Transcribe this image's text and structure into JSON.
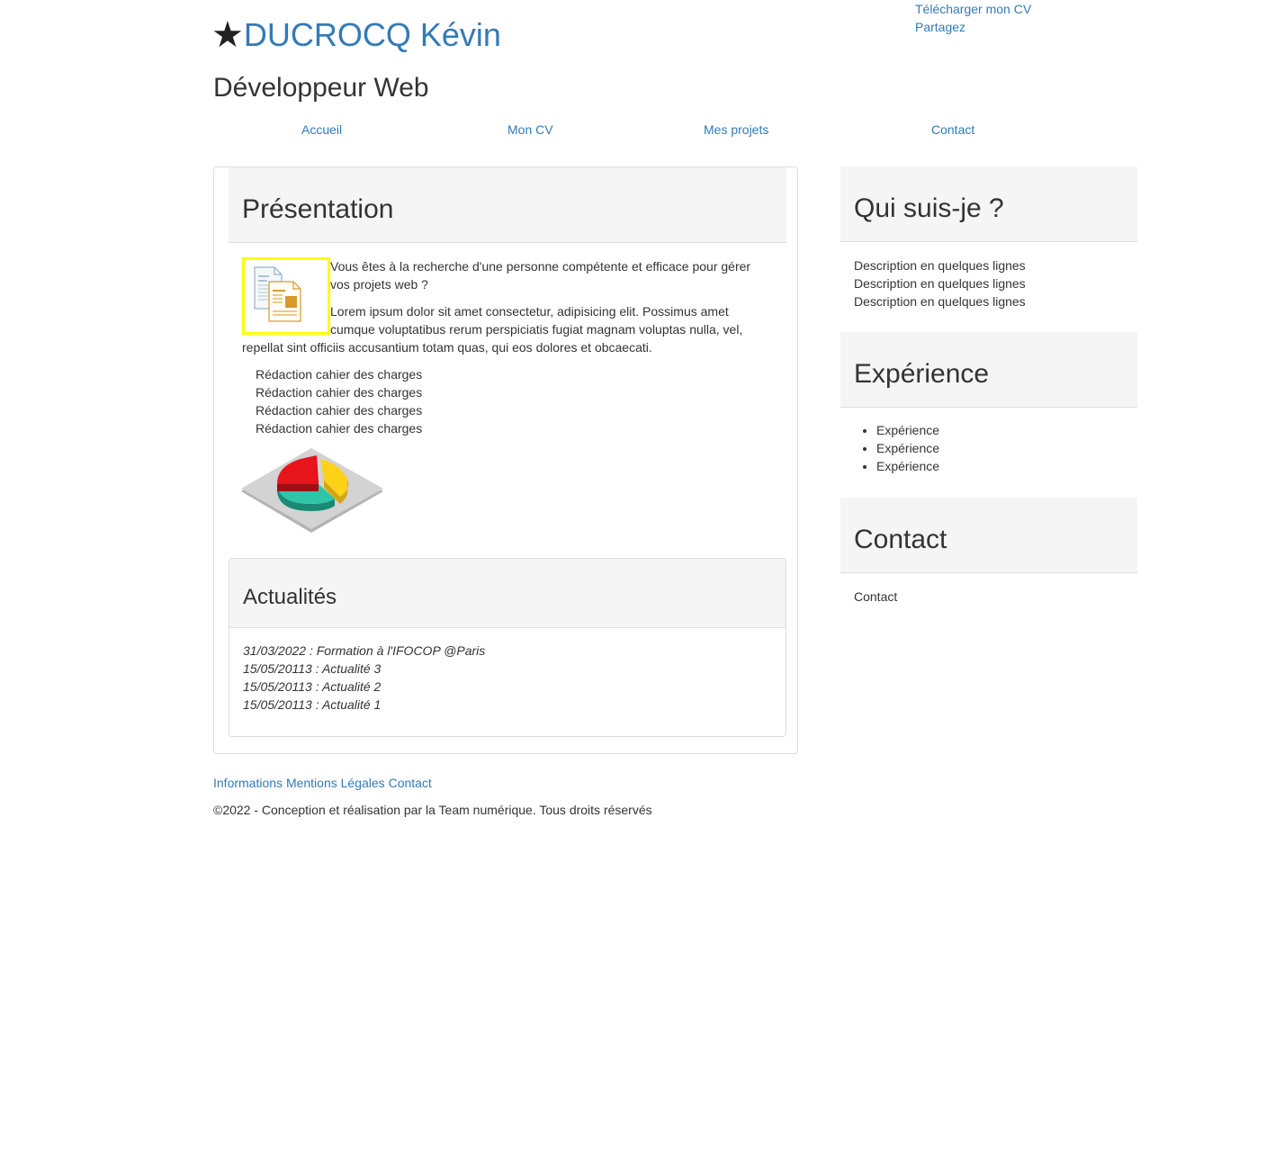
{
  "header": {
    "name": "DUCROCQ Kévin",
    "job_title": "Développeur Web",
    "star_icon": "★",
    "links": {
      "download_cv": "Télécharger mon CV",
      "share": "Partagez"
    }
  },
  "nav": {
    "items": [
      {
        "label": "Accueil"
      },
      {
        "label": "Mon CV"
      },
      {
        "label": "Mes projets"
      },
      {
        "label": "Contact"
      }
    ]
  },
  "presentation": {
    "heading": "Présentation",
    "intro": "Vous êtes à la recherche d'une personne compétente et efficace pour gérer vos projets web ?",
    "lorem": "Lorem ipsum dolor sit amet consectetur, adipisicing elit. Possimus amet cumque voluptatibus rerum perspiciatis fugiat magnam voluptas nulla, vel, repellat sint officiis accusantium totam quas, qui eos dolores et obcaecati.",
    "items": [
      "Rédaction cahier des charges",
      "Rédaction cahier des charges",
      "Rédaction cahier des charges",
      "Rédaction cahier des charges"
    ],
    "doc_image_icon": "documents-icon",
    "pie_image_icon": "pie-chart-icon",
    "highlight_color": "#ffff00"
  },
  "news": {
    "heading": "Actualités",
    "items": [
      "31/03/2022 : Formation à l'IFOCOP @Paris",
      "15/05/20113 : Actualité 3",
      "15/05/20113 : Actualité 2",
      "15/05/20113 : Actualité 1"
    ]
  },
  "sidebar": {
    "about": {
      "heading": "Qui suis-je ?",
      "lines": [
        "Description en quelques lignes",
        "Description en quelques lignes",
        "Description en quelques lignes"
      ]
    },
    "experience": {
      "heading": "Expérience",
      "items": [
        "Expérience",
        "Expérience",
        "Expérience"
      ]
    },
    "contact": {
      "heading": "Contact",
      "text": "Contact"
    }
  },
  "footer": {
    "links": {
      "informations": "Informations",
      "mentions": "Mentions Légales",
      "contact": "Contact"
    },
    "copyright_icon": "©",
    "copyright": "2022 - Conception et réalisation par la Team numérique. Tous droits réservés"
  },
  "colors": {
    "link": "#337ab7",
    "panel_bg": "#f5f5f5",
    "border": "#dddddd"
  }
}
